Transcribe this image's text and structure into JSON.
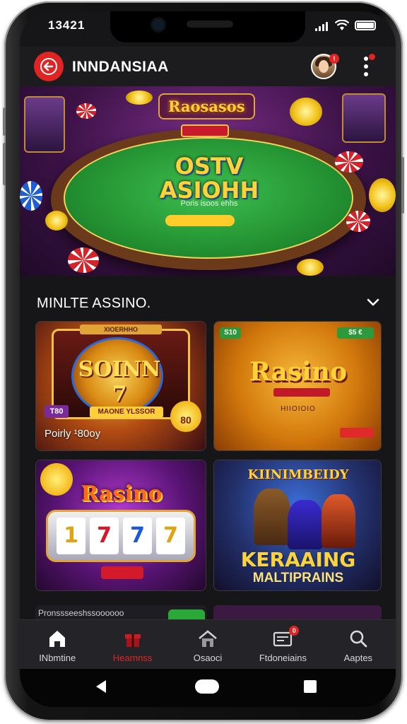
{
  "status_bar": {
    "time": "13421"
  },
  "app_bar": {
    "title": "INNDANSIAA",
    "avatar_badge": "!",
    "menu_icon": "kebab-menu-icon"
  },
  "hero": {
    "badge_text": "Raosasos",
    "title_line1": "OSTV",
    "title_line2": "ASIOHH",
    "subtitle": "Poris isoos ehhs"
  },
  "section": {
    "title": "MINLTE ASSINO.",
    "toggle_icon": "chevron-down-icon"
  },
  "games": [
    {
      "top_label": "XIOERHHO",
      "title": "SOINN 7",
      "ribbon": "MAONE YLSSOR",
      "left_tag": "T80",
      "coin_value": "80",
      "caption": "Poirly ¹80oy"
    },
    {
      "pill_left": "S10",
      "pill_right": "$5 €",
      "title": "Rasino",
      "subtitle": "HIIOIOIO"
    },
    {
      "title": "Rasino",
      "reels": [
        "1",
        "7",
        "7",
        "7"
      ]
    },
    {
      "top_title": "KIINIMBEIDY",
      "title": "KERAAING",
      "subtitle": "MALTIPRAINS"
    }
  ],
  "peek_text": "Pronssseeshssoooooo",
  "bottom_nav": [
    {
      "label": "INbmtine",
      "icon": "home-icon",
      "active": false
    },
    {
      "label": "Hearnnss",
      "icon": "gift-icon",
      "active": true
    },
    {
      "label": "Osaoci",
      "icon": "house-icon",
      "active": false
    },
    {
      "label": "Ftdoneiains",
      "icon": "inbox-icon",
      "active": false,
      "badge": "0"
    },
    {
      "label": "Aaptes",
      "icon": "search-icon",
      "active": false
    }
  ],
  "colors": {
    "accent": "#e02424",
    "background": "#161618",
    "gold": "#ffd23a"
  }
}
